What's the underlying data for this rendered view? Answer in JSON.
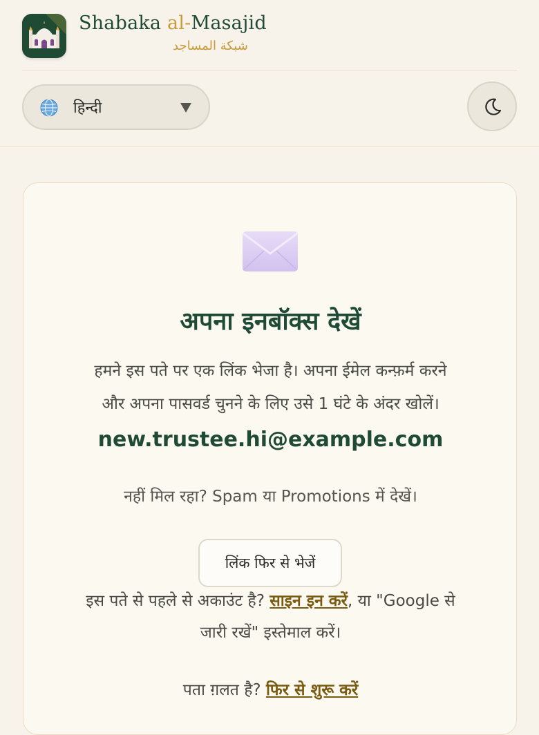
{
  "brand": {
    "name_part1": "Shabaka ",
    "name_part2": "al-",
    "name_part3": "Masajid",
    "arabic_name": "شبكة المساجد"
  },
  "toolbar": {
    "language": {
      "icon": "globe-icon",
      "selected": "हिन्दी"
    },
    "theme_toggle_icon": "moon-icon"
  },
  "card": {
    "icon": "envelope-icon",
    "title": "अपना इनबॉक्स देखें",
    "description_line1": "हमने इस पते पर एक लिंक भेजा है। अपना ईमेल कन्फ़र्म करने",
    "description_line2": "और अपना पासवर्ड चुनने के लिए उसे 1 घंटे के अंदर खोलें।",
    "email": "new.trustee.hi@example.com",
    "spam_hint": "नहीं मिल रहा? Spam या Promotions में देखें।",
    "resend_label": "लिंक फिर से भेजें",
    "signin_prefix": "इस पते से पहले से अकाउंट है? ",
    "signin_link": "साइन इन करें",
    "signin_suffix": ", या \"Google से",
    "signin_line2": "जारी रखें\" इस्तेमाल करें।",
    "restart_prefix": "पता ग़लत है? ",
    "restart_link": "फिर से शुरू करें"
  },
  "colors": {
    "background": "#f7f2ea",
    "brand_green": "#1f4a33",
    "gold": "#c79a3a",
    "link": "#7a5a10"
  }
}
